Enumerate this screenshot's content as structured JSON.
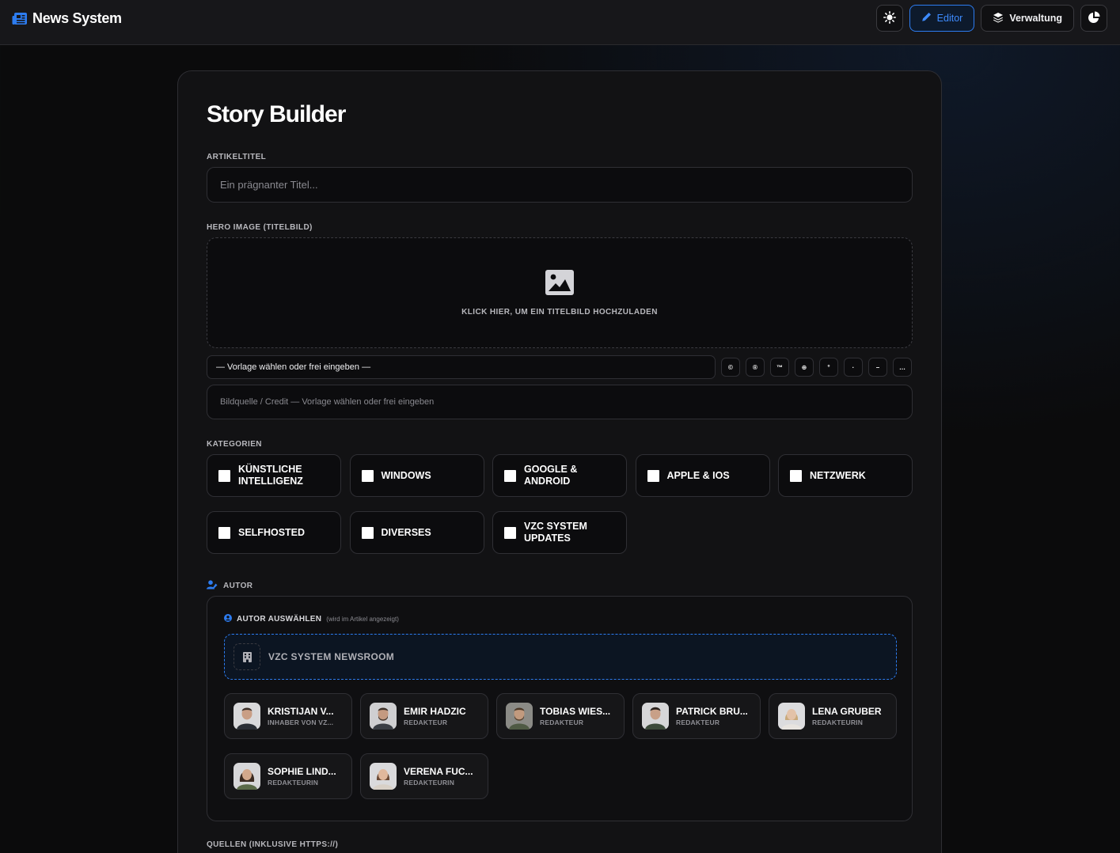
{
  "app": {
    "title": "News System"
  },
  "header": {
    "editor_label": "Editor",
    "verwaltung_label": "Verwaltung"
  },
  "colors": {
    "accent": "#2d7cf0",
    "background": "#0b0b0c",
    "card": "#121214"
  },
  "page": {
    "title": "Story Builder"
  },
  "article_title": {
    "label": "ARTIKELTITEL",
    "placeholder": "Ein prägnanter Titel...",
    "value": ""
  },
  "hero": {
    "label": "HERO IMAGE (TITELBILD)",
    "upload_text": "KLICK HIER, UM EIN TITELBILD HOCHZULADEN",
    "template_select": "— Vorlage wählen oder frei eingeben —",
    "symbols": [
      "©",
      "®",
      "™",
      "⊕",
      "°",
      "·",
      "–",
      "…"
    ],
    "credit_placeholder": "Bildquelle / Credit — Vorlage wählen oder frei eingeben"
  },
  "categories": {
    "label": "KATEGORIEN",
    "items": [
      "Künstliche Intelligenz",
      "Windows",
      "Google & Android",
      "Apple & iOS",
      "Netzwerk",
      "Selfhosted",
      "Diverses",
      "VZC System Updates"
    ]
  },
  "author": {
    "label": "AUTOR",
    "select_title": "AUTOR AUSWÄHLEN",
    "select_note": "(wird im Artikel angezeigt)",
    "newsroom": "VZC SYSTEM NEWSROOM",
    "people": [
      {
        "name": "KRISTIJAN V...",
        "role": "INHABER VON VZ..."
      },
      {
        "name": "EMIR HADZIC",
        "role": "REDAKTEUR"
      },
      {
        "name": "TOBIAS WIES...",
        "role": "REDAKTEUR"
      },
      {
        "name": "PATRICK BRU...",
        "role": "REDAKTEUR"
      },
      {
        "name": "LENA GRUBER",
        "role": "REDAKTEURIN"
      },
      {
        "name": "SOPHIE LIND...",
        "role": "REDAKTEURIN"
      },
      {
        "name": "VERENA FUC...",
        "role": "REDAKTEURIN"
      }
    ]
  },
  "sources": {
    "label": "QUELLEN (INKLUSIVE HTTPS://)"
  }
}
